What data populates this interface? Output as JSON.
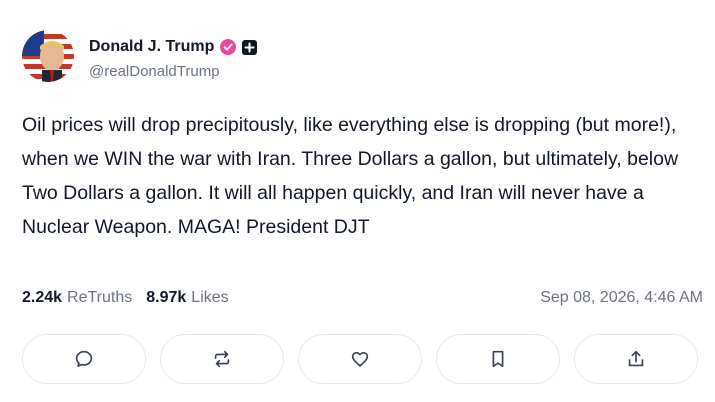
{
  "author": {
    "display_name": "Donald J. Trump",
    "handle": "@realDonaldTrump"
  },
  "post": {
    "text": "Oil prices will drop precipitously, like everything else is dropping (but more!), when we WIN the war with Iran. Three Dollars a gallon, but ultimately, below Two Dollars a gallon. It will all happen quickly, and Iran will never have a Nuclear Weapon. MAGA! President DJT"
  },
  "stats": {
    "retruths_count": "2.24k",
    "retruths_label": "ReTruths",
    "likes_count": "8.97k",
    "likes_label": "Likes",
    "timestamp": "Sep 08, 2026, 4:46 AM"
  },
  "actions": {
    "icons": [
      "comment-icon",
      "retruth-icon",
      "heart-icon",
      "bookmark-icon",
      "share-icon"
    ]
  },
  "colors": {
    "verified_badge": "#ec4899",
    "text_primary": "#111827",
    "text_secondary": "#6b7280",
    "border": "#e5e7eb"
  }
}
